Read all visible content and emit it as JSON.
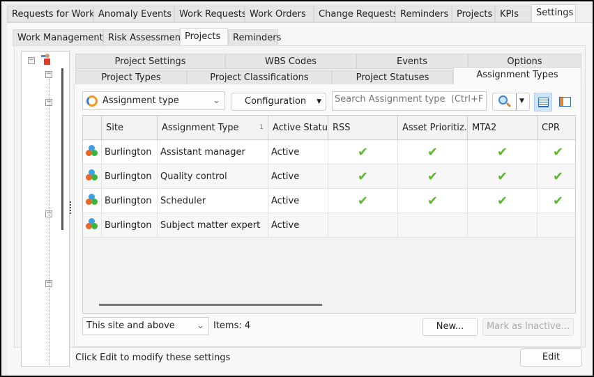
{
  "top_tabs": [
    "Requests for Work",
    "Anomaly Events",
    "Work Requests",
    "Work Orders",
    "Change Requests",
    "Reminders",
    "Projects",
    "KPIs",
    "Settings"
  ],
  "top_active": "Settings",
  "sub_tabs": [
    "Work Management",
    "Risk Assessment",
    "Projects",
    "Reminders"
  ],
  "sub_active": "Projects",
  "inner_tabs_row1": [
    "Project Settings",
    "WBS Codes",
    "Events",
    "Options"
  ],
  "inner_tabs_row2": [
    "Project Types",
    "Project Classifications",
    "Project Statuses",
    "Assignment Types"
  ],
  "inner_active": "Assignment Types",
  "toolbar": {
    "view_select": "Assignment type",
    "configuration": "Configuration",
    "search_placeholder": "Search Assignment type  (Ctrl+F)"
  },
  "grid": {
    "columns": [
      "Site",
      "Assignment Type",
      "Active Status",
      "RSS",
      "Asset Prioritiz...",
      "MTA2",
      "CPR"
    ],
    "sort_indicator": "1",
    "rows": [
      {
        "site": "Burlington",
        "type": "Assistant manager",
        "status": "Active",
        "checks": [
          true,
          true,
          true,
          true
        ]
      },
      {
        "site": "Burlington",
        "type": "Quality control",
        "status": "Active",
        "checks": [
          true,
          true,
          true,
          true
        ]
      },
      {
        "site": "Burlington",
        "type": "Scheduler",
        "status": "Active",
        "checks": [
          true,
          true,
          true,
          true
        ]
      },
      {
        "site": "Burlington",
        "type": "Subject matter expert",
        "status": "Active",
        "checks": [
          false,
          false,
          false,
          false
        ]
      }
    ]
  },
  "footer": {
    "scope_select": "This site and above",
    "items": "Items: 4",
    "new": "New...",
    "mark_inactive": "Mark as Inactive..."
  },
  "status_text": "Click Edit to modify these settings",
  "edit": "Edit"
}
